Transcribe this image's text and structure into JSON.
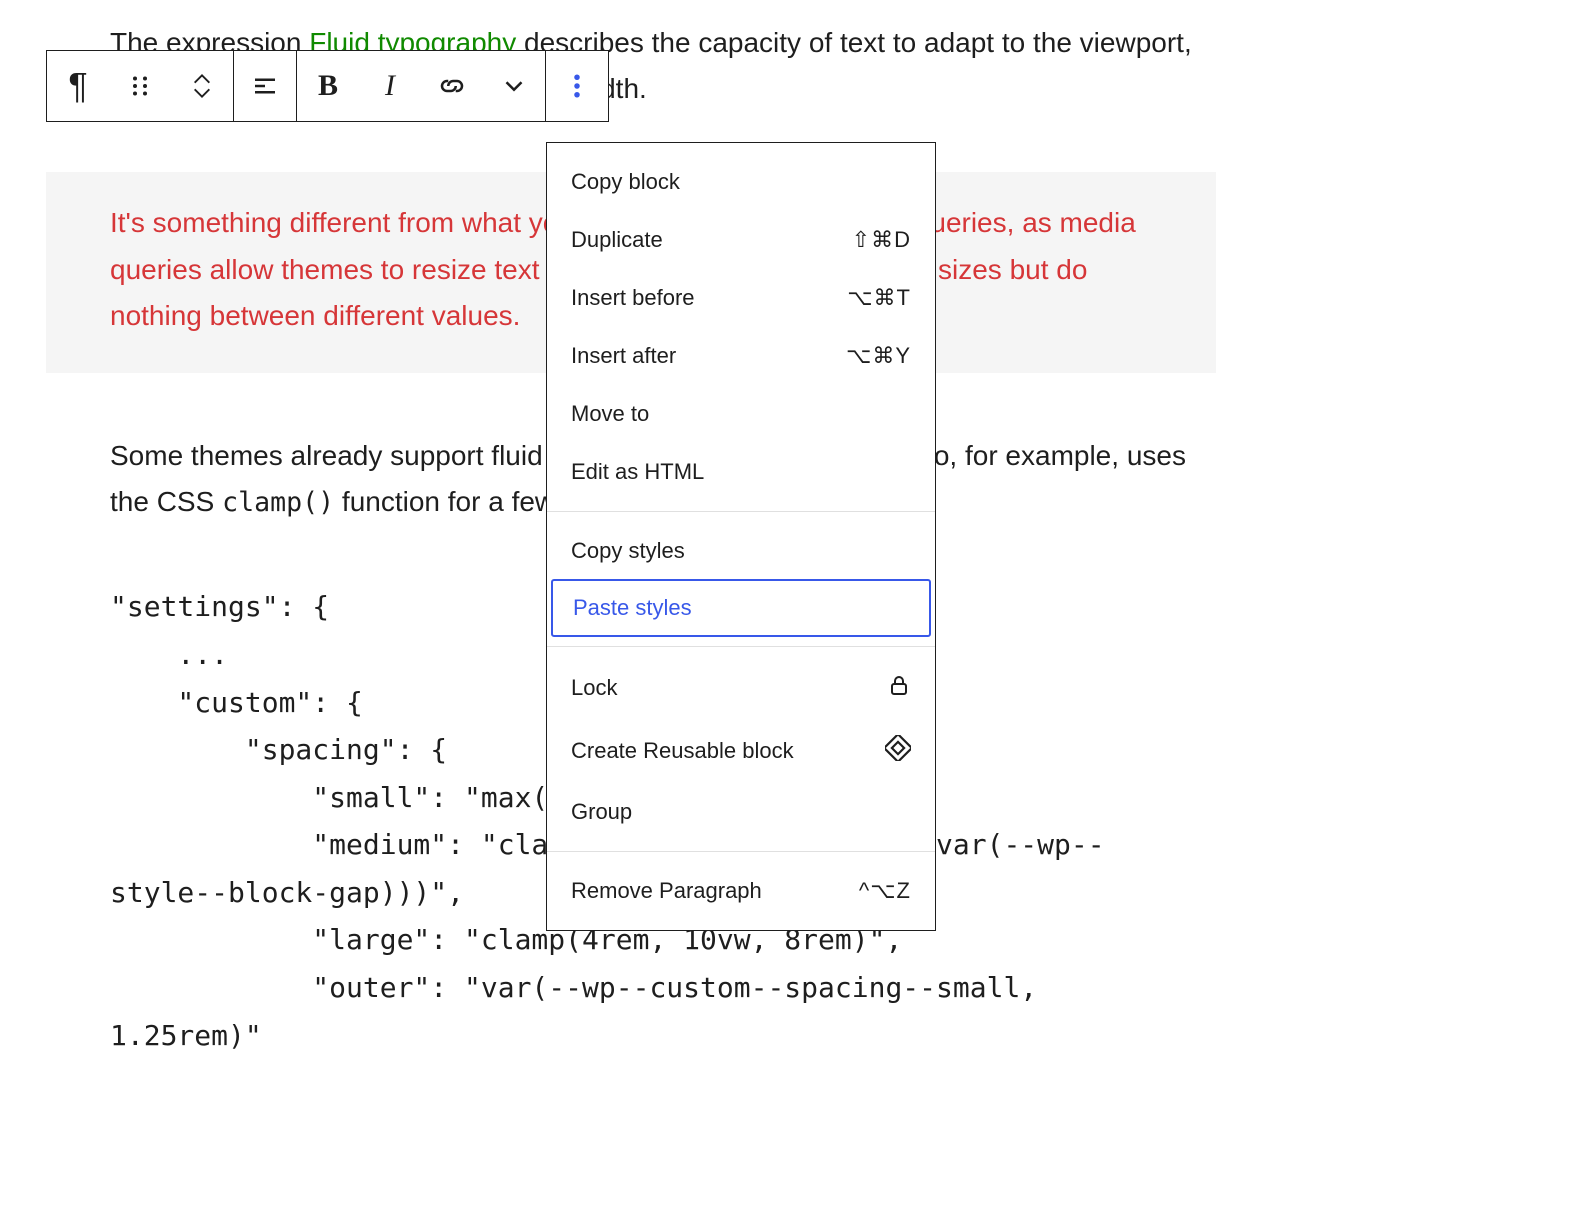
{
  "content": {
    "para1_a": "The expression ",
    "para1_link": "Fluid typography",
    "para1_b": " describes the capacity of text to adapt to the viewport, scaling from a minimum to maximum width.",
    "highlight": "It's something different from what you can already do with media queries, as media queries allow themes to resize text depending on specific viewport sizes but do nothing between different values.",
    "para3_a": "Some themes already support fluid typography: ",
    "para3_link": "Twenty Twenty-Two",
    "para3_b": ", for example, uses the CSS ",
    "para3_code": "clamp()",
    "para3_c": " function for a few custom font sizes:",
    "codeblock": "\"settings\": {\n    ...\n    \"custom\": {\n        \"spacing\": {\n            \"small\": \"max(1.25rem, 5vw)\",\n            \"medium\": \"clamp(2rem, 8vw, calc(4 * var(--wp--\nstyle--block-gap)))\",\n            \"large\": \"clamp(4rem, 10vw, 8rem)\",\n            \"outer\": \"var(--wp--custom--spacing--small,\n1.25rem)\""
  },
  "menu": {
    "copy_block": "Copy block",
    "duplicate": "Duplicate",
    "duplicate_key": "⇧⌘D",
    "insert_before": "Insert before",
    "insert_before_key": "⌥⌘T",
    "insert_after": "Insert after",
    "insert_after_key": "⌥⌘Y",
    "move_to": "Move to",
    "edit_html": "Edit as HTML",
    "copy_styles": "Copy styles",
    "paste_styles": "Paste styles",
    "lock": "Lock",
    "create_reusable": "Create Reusable block",
    "group": "Group",
    "remove": "Remove Paragraph",
    "remove_key": "^⌥Z"
  }
}
